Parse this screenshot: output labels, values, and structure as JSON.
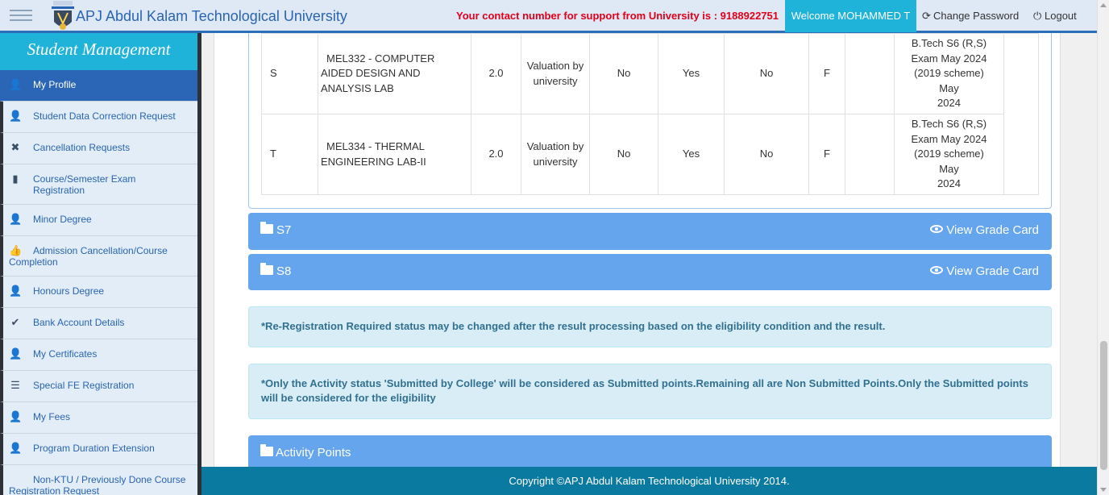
{
  "header": {
    "title": "APJ Abdul Kalam Technological University",
    "support_text": "Your contact number for support from University is : 9188922751",
    "welcome": "Welcome MOHAMMED T",
    "change_password": "Change Password",
    "logout": "Logout"
  },
  "sidebar": {
    "heading": "Student Management",
    "items": [
      {
        "label": "My Profile",
        "icon": "user-icon"
      },
      {
        "label": "Student Data Correction Request",
        "icon": "user-icon"
      },
      {
        "label": "Cancellation Requests",
        "icon": "cancel-circle-icon"
      },
      {
        "label": "Course/Semester Exam Registration",
        "icon": "book-icon"
      },
      {
        "label": "Minor Degree",
        "icon": "user-icon"
      },
      {
        "label": "Admission Cancellation/Course Completion",
        "icon": "thumbs-up-icon"
      },
      {
        "label": "Honours Degree",
        "icon": "user-icon"
      },
      {
        "label": "Bank Account Details",
        "icon": "check-icon"
      },
      {
        "label": "My Certificates",
        "icon": "user-icon"
      },
      {
        "label": "Special FE Registration",
        "icon": "list-icon"
      },
      {
        "label": "My Fees",
        "icon": "user-icon"
      },
      {
        "label": "Program Duration Extension",
        "icon": "user-icon"
      },
      {
        "label": "Non-KTU / Previously Done Course Registration Request",
        "icon": ""
      }
    ]
  },
  "grades": {
    "rows": [
      {
        "slot": "S",
        "course": "MEL332 - COMPUTER AIDED DESIGN AND ANALYSIS LAB",
        "credit": "2.0",
        "valuation": "Valuation by university",
        "c5": "No",
        "c6": "Yes",
        "c7": "No",
        "grade": "F",
        "c9": "",
        "exam": "B.Tech S6 (R,S) Exam May 2024 (2019 scheme)",
        "month": "May",
        "year": "2024"
      },
      {
        "slot": "T",
        "course": "MEL334 - THERMAL ENGINEERING LAB-II",
        "credit": "2.0",
        "valuation": "Valuation by university",
        "c5": "No",
        "c6": "Yes",
        "c7": "No",
        "grade": "F",
        "c9": "",
        "exam": "B.Tech S6 (R,S) Exam May 2024 (2019 scheme)",
        "month": "May",
        "year": "2024"
      }
    ]
  },
  "semesters": [
    {
      "label": "S7",
      "action": "View Grade Card"
    },
    {
      "label": "S8",
      "action": "View Grade Card"
    }
  ],
  "notes": {
    "reregistration": "*Re-Registration Required status may be changed after the result processing based on the eligibility condition and the result.",
    "activity": "*Only the Activity status 'Submitted by College' will be considered as Submitted points.Remaining all are Non Submitted Points.Only the Submitted points will be considered for the eligibility"
  },
  "activity_panel": {
    "label": "Activity Points"
  },
  "footer": {
    "text": "Copyright ©APJ Abdul Kalam Technological University 2014."
  },
  "colors": {
    "accent": "#1fb3d9",
    "primary": "#2b65b5",
    "panel": "#64a5ee",
    "alert_text": "#31708f",
    "footer": "#0b7aa1",
    "support": "#e0001b"
  }
}
